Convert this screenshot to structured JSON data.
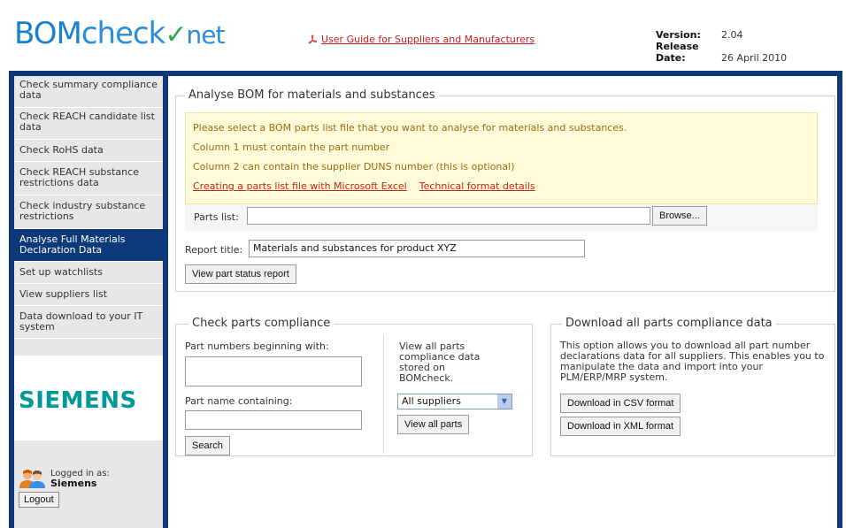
{
  "header": {
    "logo_bom": "BOM",
    "logo_check": "check",
    "logo_net": "net",
    "guide_link": "User Guide for Suppliers and Manufacturers",
    "version_label": "Version:",
    "version_value": "2.04",
    "release_label": "Release Date:",
    "release_value": "26 April 2010"
  },
  "sidebar": {
    "items": [
      {
        "label": "Check summary compliance data",
        "active": false
      },
      {
        "label": "Check REACH candidate list data",
        "active": false
      },
      {
        "label": "Check RoHS data",
        "active": false
      },
      {
        "label": "Check REACH substance restrictions data",
        "active": false
      },
      {
        "label": "Check industry substance restrictions",
        "active": false
      },
      {
        "label": "Analyse Full Materials Declaration Data",
        "active": true
      },
      {
        "label": "Set up watchlists",
        "active": false
      },
      {
        "label": "View suppliers list",
        "active": false
      },
      {
        "label": "Data download to your IT system",
        "active": false
      }
    ],
    "company_logo": "SIEMENS",
    "logged_in_label": "Logged in as:",
    "logged_in_user": "Siemens",
    "logout_label": "Logout"
  },
  "analyse": {
    "legend": "Analyse BOM for materials and substances",
    "notice_line1": "Please select a BOM parts list file that you want to analyse for materials and substances.",
    "notice_line2": "Column 1 must contain the part number",
    "notice_line3": "Column 2 can contain the supplier DUNS number (this is optional)",
    "link_excel": "Creating a parts list file with Microsoft Excel",
    "link_format": "Technical format details",
    "parts_list_label": "Parts list:",
    "parts_list_value": "",
    "browse_label": "Browse...",
    "report_title_label": "Report title:",
    "report_title_value": "Materials and substances for product XYZ",
    "view_report_label": "View part status report"
  },
  "check_parts": {
    "legend": "Check parts compliance",
    "part_numbers_label": "Part numbers beginning with:",
    "part_numbers_value": "",
    "part_name_label": "Part name containing:",
    "part_name_value": "",
    "search_label": "Search",
    "view_all_text": "View all parts compliance data stored on BOMcheck.",
    "supplier_select": "All suppliers",
    "view_all_label": "View all parts"
  },
  "download": {
    "legend": "Download all parts compliance data",
    "description": "This option allows you to download all part number declarations data for all suppliers. This enables you to manipulate the data and import into your PLM/ERP/MRP system.",
    "csv_label": "Download in CSV format",
    "xml_label": "Download in XML format"
  },
  "icons": {
    "pdf": "pdf-icon",
    "users": "users-icon",
    "dropdown": "chevron-down-icon"
  }
}
